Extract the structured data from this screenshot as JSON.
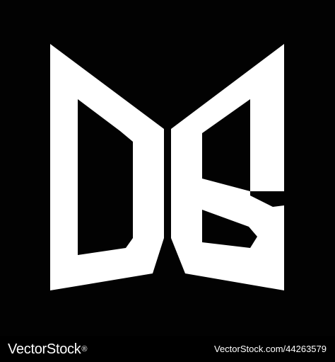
{
  "logo": {
    "monogram": "DB",
    "colors": {
      "background": "#020202",
      "foreground": "#ffffff"
    }
  },
  "footer": {
    "brand_name": "VectorStock",
    "brand_mark": "®",
    "image_ref": "VectorStock.com/44263579"
  }
}
